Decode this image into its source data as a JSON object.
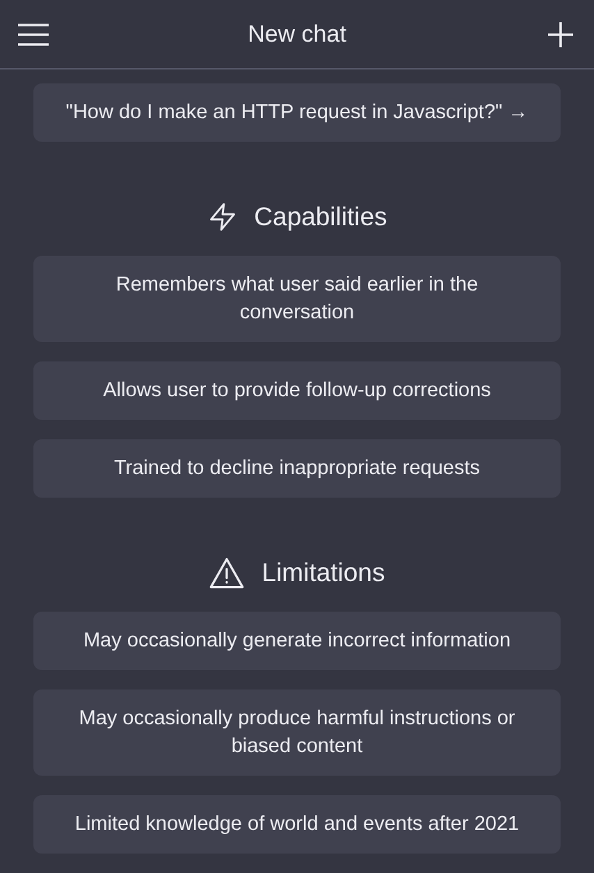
{
  "header": {
    "title": "New chat"
  },
  "example": {
    "text": "\"How do I make an HTTP request in Javascript?\" →"
  },
  "sections": [
    {
      "kind": "capabilities",
      "title": "Capabilities",
      "items": [
        "Remembers what user said earlier in the conversation",
        "Allows user to provide follow-up corrections",
        "Trained to decline inappropriate requests"
      ]
    },
    {
      "kind": "limitations",
      "title": "Limitations",
      "items": [
        "May occasionally generate incorrect information",
        "May occasionally produce harmful instructions or biased content",
        "Limited knowledge of world and events after 2021"
      ]
    }
  ]
}
